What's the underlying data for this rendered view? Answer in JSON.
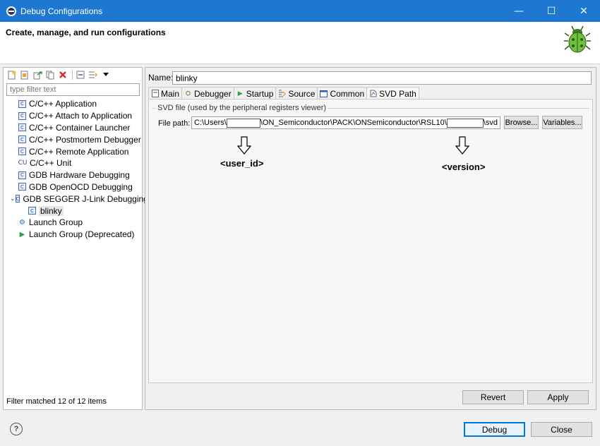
{
  "window": {
    "title": "Debug Configurations",
    "controls": {
      "minimize": "—",
      "maximize": "☐",
      "close": "✕"
    }
  },
  "header": {
    "title": "Create, manage, and run configurations"
  },
  "left_panel": {
    "filter_placeholder": "type filter text",
    "tree": [
      {
        "label": "C/C++ Application",
        "icon": "c-config-icon"
      },
      {
        "label": "C/C++ Attach to Application",
        "icon": "c-config-icon"
      },
      {
        "label": "C/C++ Container Launcher",
        "icon": "c-config-icon"
      },
      {
        "label": "C/C++ Postmortem Debugger",
        "icon": "c-config-icon"
      },
      {
        "label": "C/C++ Remote Application",
        "icon": "c-config-icon"
      },
      {
        "label": "C/C++ Unit",
        "icon": "cu-icon"
      },
      {
        "label": "GDB Hardware Debugging",
        "icon": "c-config-icon"
      },
      {
        "label": "GDB OpenOCD Debugging",
        "icon": "c-config-icon"
      },
      {
        "label": "GDB SEGGER J-Link Debugging",
        "icon": "c-config-icon",
        "expanded": true
      },
      {
        "label": "blinky",
        "icon": "c-config-icon",
        "child": true,
        "selected": true
      },
      {
        "label": "Launch Group",
        "icon": "launch-group-icon"
      },
      {
        "label": "Launch Group (Deprecated)",
        "icon": "launch-play-icon"
      }
    ],
    "status": "Filter matched 12 of 12 items"
  },
  "right_panel": {
    "name_label": "Name:",
    "name_value": "blinky",
    "tabs": [
      {
        "label": "Main",
        "icon": "main-tab-icon"
      },
      {
        "label": "Debugger",
        "icon": "debugger-tab-icon"
      },
      {
        "label": "Startup",
        "icon": "startup-tab-icon"
      },
      {
        "label": "Source",
        "icon": "source-tab-icon"
      },
      {
        "label": "Common",
        "icon": "common-tab-icon"
      },
      {
        "label": "SVD Path",
        "icon": "svd-tab-icon",
        "active": true
      }
    ],
    "svd": {
      "group_title": "SVD file (used by the peripheral registers viewer)",
      "file_path_label": "File path:",
      "path_part1": "C:\\Users\\",
      "path_part2": "\\ON_Semiconductor\\PACK\\ONSemiconductor\\RSL10\\",
      "path_part3": "\\svd",
      "browse_label": "Browse...",
      "variables_label": "Variables..."
    },
    "annotations": {
      "user_id": "<user_id>",
      "version": "<version>"
    },
    "revert_label": "Revert",
    "apply_label": "Apply"
  },
  "footer": {
    "help_symbol": "?",
    "debug_label": "Debug",
    "close_label": "Close"
  }
}
